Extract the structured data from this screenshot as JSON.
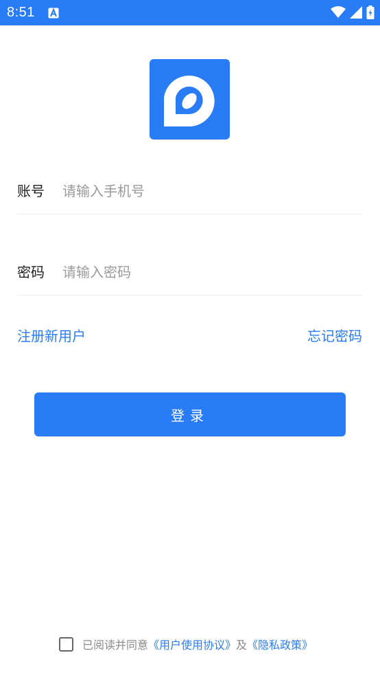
{
  "status_bar": {
    "time": "8:51",
    "background_color": "#2a7cf6",
    "icons": [
      "a-notification-icon",
      "wifi-icon",
      "signal-icon",
      "battery-charging-icon"
    ]
  },
  "logo": {
    "icon": "app-logo-icon",
    "color": "#2a7cf6"
  },
  "account": {
    "label": "账号",
    "placeholder": "请输入手机号",
    "value": ""
  },
  "password": {
    "label": "密码",
    "placeholder": "请输入密码",
    "value": ""
  },
  "links": {
    "register": "注册新用户",
    "forgot": "忘记密码"
  },
  "login_button": {
    "label": "登录"
  },
  "agreement": {
    "checked": false,
    "prefix": "已阅读并同意",
    "user_agreement": "《用户使用协议》",
    "conjunction": "及",
    "privacy_policy": "《隐私政策》"
  }
}
